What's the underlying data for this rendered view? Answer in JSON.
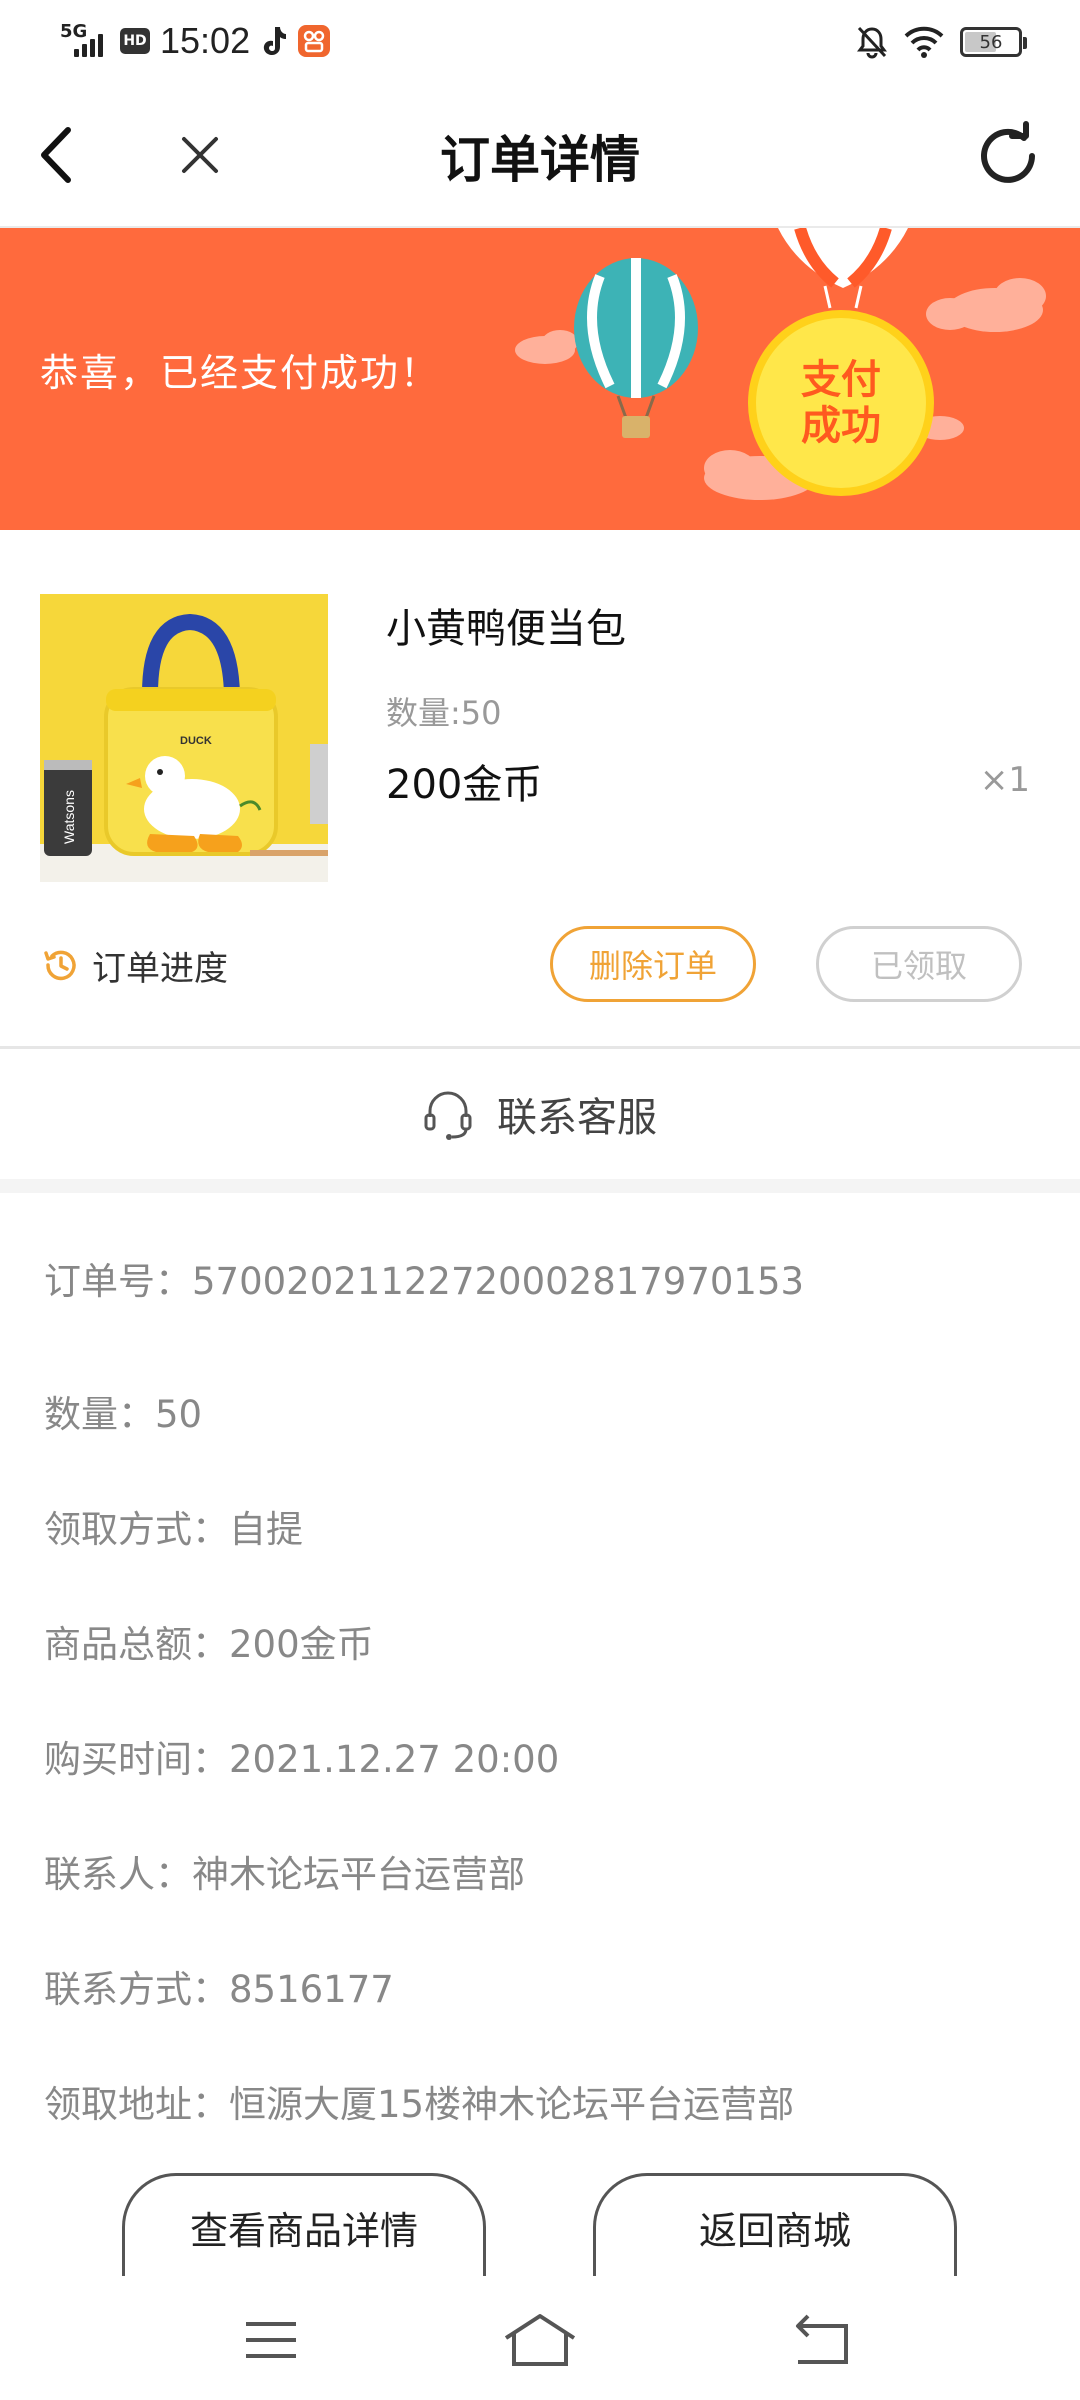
{
  "status_bar": {
    "network": "5G",
    "hd": "HD",
    "time": "15:02",
    "battery": "56"
  },
  "navbar": {
    "title": "订单详情"
  },
  "banner": {
    "message": "恭喜，已经支付成功！",
    "badge_line1": "支付",
    "badge_line2": "成功",
    "bg_color": "#ff6a3d"
  },
  "product": {
    "name": "小黄鸭便当包",
    "quantity_label": "数量:50",
    "price": "200金币",
    "multiplier": "×1",
    "image_text": "DUCK",
    "can_text": "Watsons"
  },
  "actions": {
    "progress_label": "订单进度",
    "delete_label": "删除订单",
    "received_label": "已领取"
  },
  "service": {
    "label": "联系客服"
  },
  "info": [
    "订单号：57002021122720002817970153",
    "数量：50",
    "领取方式：自提",
    "商品总额：200金币",
    "购买时间：2021.12.27 20:00",
    "联系人：神木论坛平台运营部",
    "联系方式：8516177",
    "领取地址：恒源大厦15楼神木论坛平台运营部"
  ],
  "bottom_buttons": {
    "detail_label": "查看商品详情",
    "back_label": "返回商城"
  },
  "colors": {
    "accent_orange": "#f0a336",
    "banner_orange": "#ff6a3d"
  }
}
